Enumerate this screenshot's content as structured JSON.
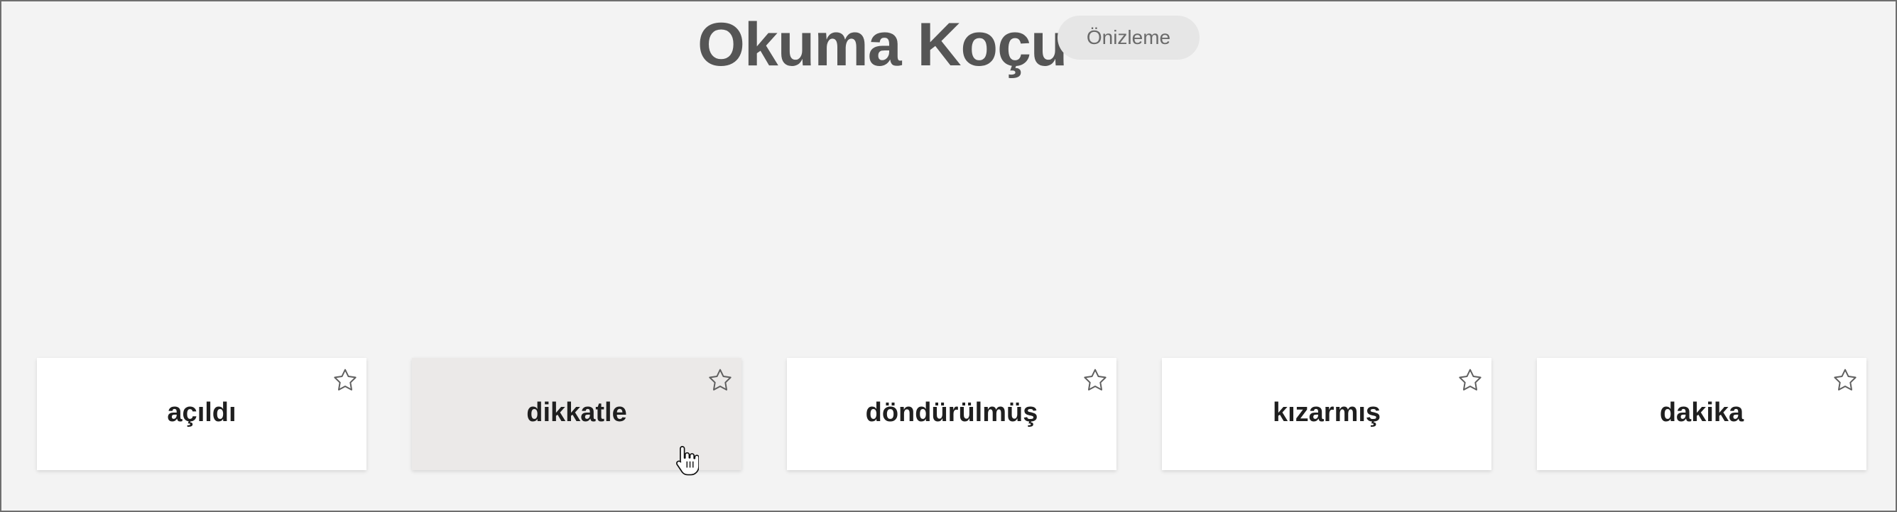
{
  "header": {
    "title": "Okuma Koçu",
    "badge": "Önizleme"
  },
  "cards": [
    {
      "word": "açıldı",
      "starred": false,
      "hovered": false
    },
    {
      "word": "dikkatle",
      "starred": false,
      "hovered": true
    },
    {
      "word": "döndürülmüş",
      "starred": false,
      "hovered": false
    },
    {
      "word": "kızarmış",
      "starred": false,
      "hovered": false
    },
    {
      "word": "dakika",
      "starred": false,
      "hovered": false
    }
  ],
  "icons": {
    "star": "star-outline-icon",
    "cursor": "hand-pointer-cursor"
  },
  "colors": {
    "background": "#f3f3f3",
    "card": "#ffffff",
    "card_hover": "#ebe9e8",
    "title": "#555555",
    "badge_bg": "#e6e6e6"
  }
}
